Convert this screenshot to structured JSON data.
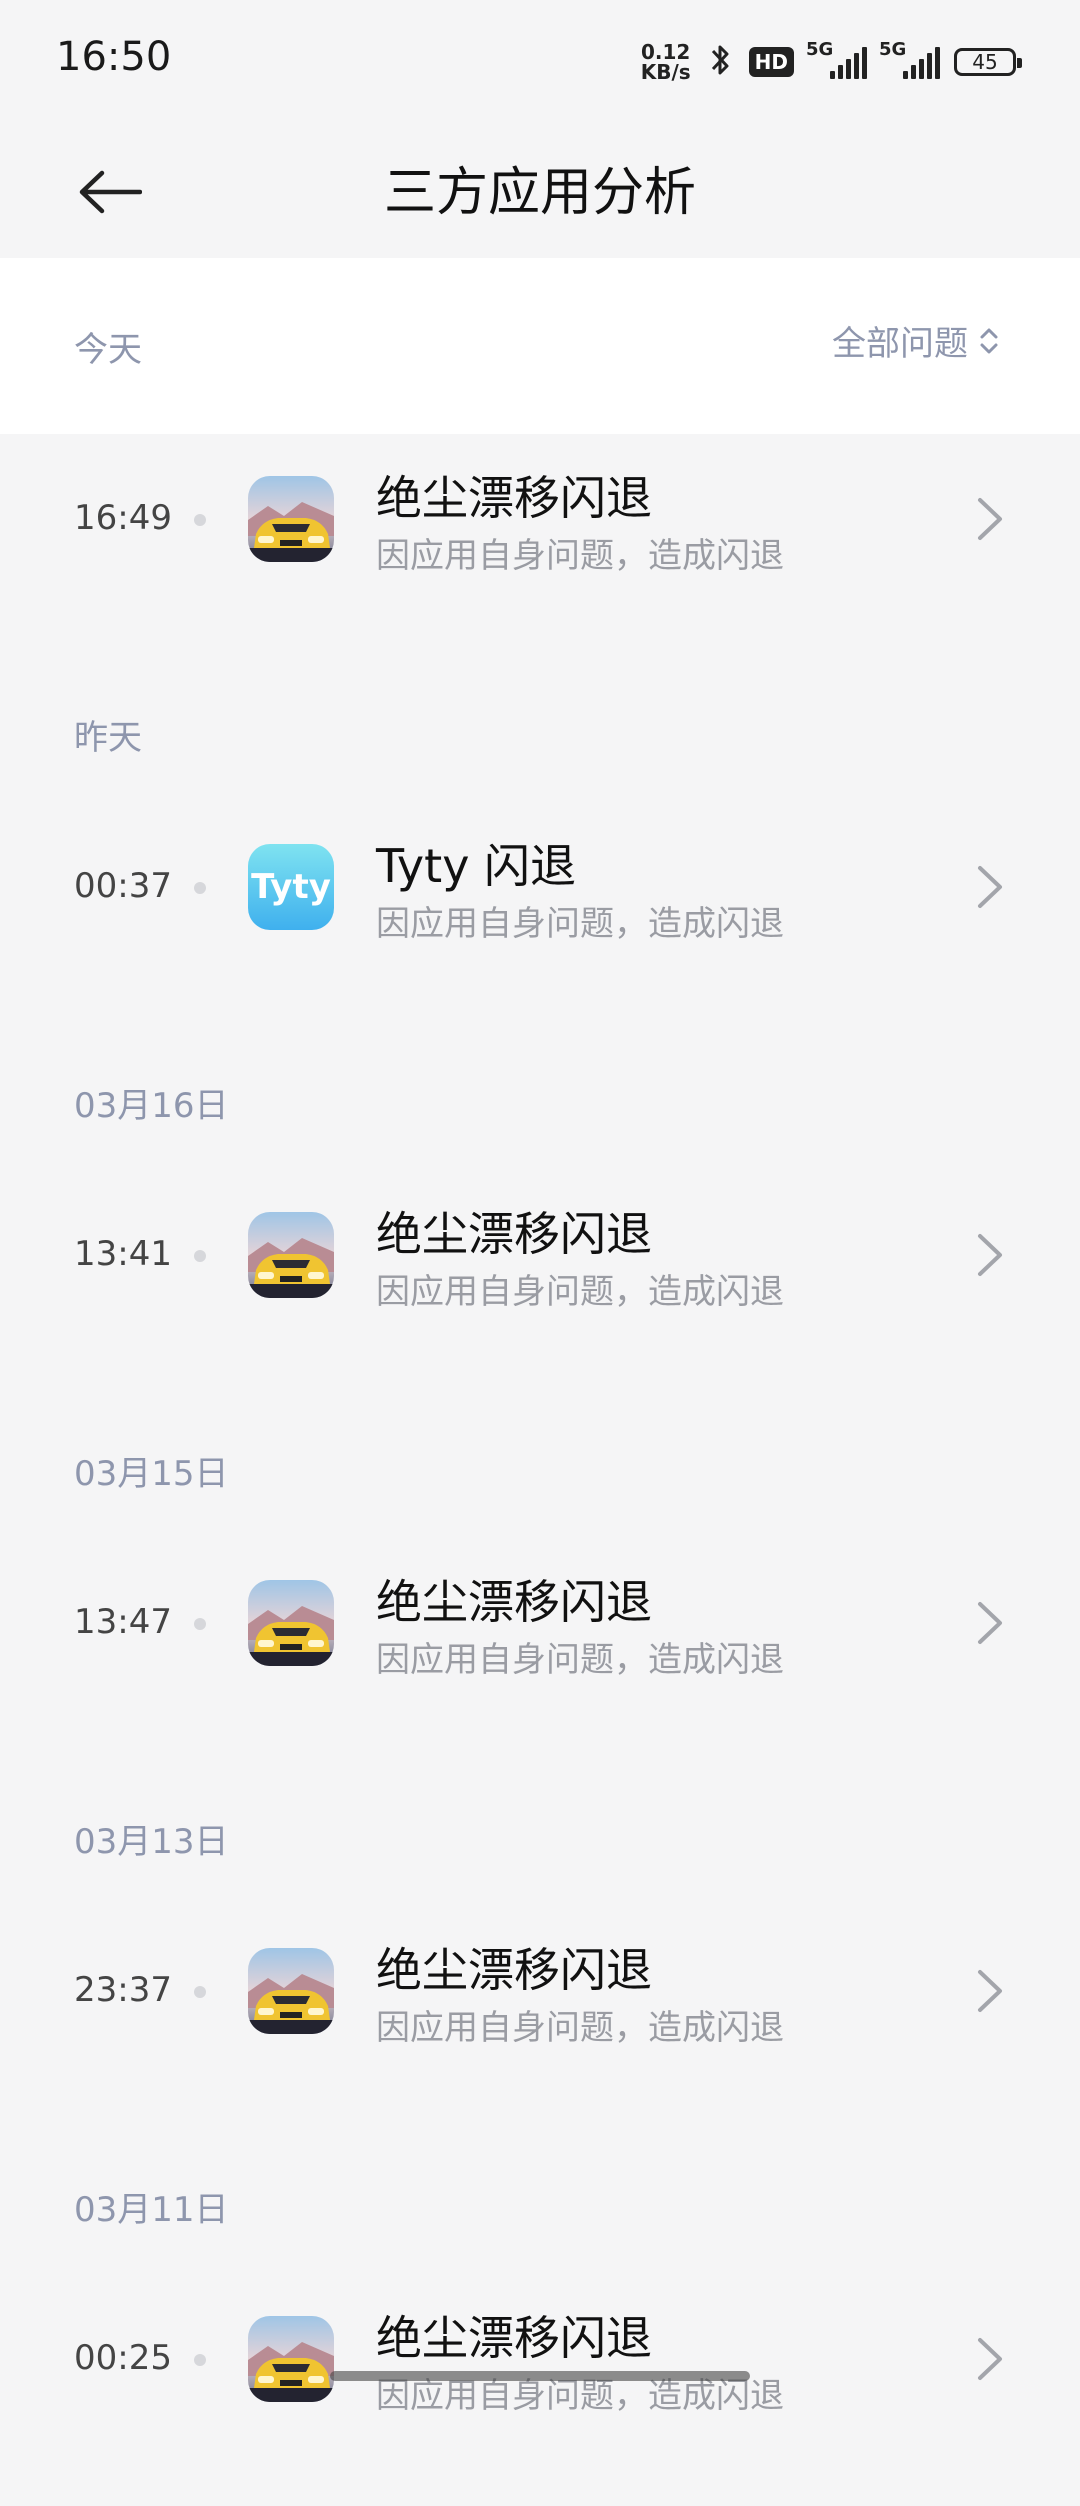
{
  "status_bar": {
    "time": "16:50",
    "net_speed_value": "0.12",
    "net_speed_unit": "KB/s",
    "hd": "HD",
    "signal_label_1": "5G",
    "signal_label_2": "5G",
    "battery": "45"
  },
  "header": {
    "title": "三方应用分析"
  },
  "filter": {
    "date_label": "今天",
    "dropdown_label": "全部问题"
  },
  "colors": {
    "section_text": "#8e96ad",
    "tyty_icon": "#3fb0ee"
  },
  "entries": [
    {
      "time": "16:49",
      "title": "绝尘漂移闪退",
      "subtitle": "因应用自身问题，造成闪退",
      "icon": "car-game-icon"
    },
    {
      "section": "昨天"
    },
    {
      "time": "00:37",
      "title": "Tyty 闪退",
      "subtitle": "因应用自身问题，造成闪退",
      "icon": "tyty-app-icon",
      "icon_text": "Tyty"
    },
    {
      "section": "03月16日"
    },
    {
      "time": "13:41",
      "title": "绝尘漂移闪退",
      "subtitle": "因应用自身问题，造成闪退",
      "icon": "car-game-icon"
    },
    {
      "section": "03月15日"
    },
    {
      "time": "13:47",
      "title": "绝尘漂移闪退",
      "subtitle": "因应用自身问题，造成闪退",
      "icon": "car-game-icon"
    },
    {
      "section": "03月13日"
    },
    {
      "time": "23:37",
      "title": "绝尘漂移闪退",
      "subtitle": "因应用自身问题，造成闪退",
      "icon": "car-game-icon"
    },
    {
      "section": "03月11日"
    },
    {
      "time": "00:25",
      "title": "绝尘漂移闪退",
      "subtitle": "因应用自身问题，造成闪退",
      "icon": "car-game-icon"
    }
  ]
}
